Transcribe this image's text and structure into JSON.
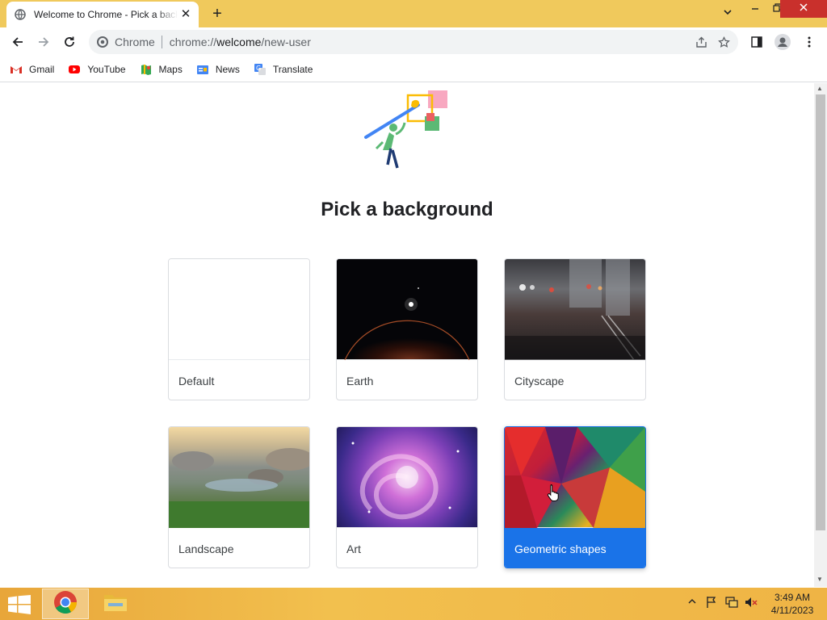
{
  "browser": {
    "tab_title": "Welcome to Chrome - Pick a background",
    "new_tab_symbol": "+",
    "omnibox": {
      "chip_label": "Chrome",
      "url_prefix": "chrome://",
      "url_host": "welcome",
      "url_path": "/new-user"
    },
    "bookmarks": [
      {
        "label": "Gmail",
        "icon": "gmail-icon"
      },
      {
        "label": "YouTube",
        "icon": "youtube-icon"
      },
      {
        "label": "Maps",
        "icon": "maps-icon"
      },
      {
        "label": "News",
        "icon": "news-icon"
      },
      {
        "label": "Translate",
        "icon": "translate-icon"
      }
    ]
  },
  "page": {
    "heading": "Pick a background",
    "backgrounds": [
      {
        "label": "Default",
        "selected": false
      },
      {
        "label": "Earth",
        "selected": false
      },
      {
        "label": "Cityscape",
        "selected": false
      },
      {
        "label": "Landscape",
        "selected": false
      },
      {
        "label": "Art",
        "selected": false
      },
      {
        "label": "Geometric shapes",
        "selected": true
      }
    ]
  },
  "taskbar": {
    "clock_time": "3:49 AM",
    "clock_date": "4/11/2023"
  },
  "colors": {
    "tab_strip": "#f0c95c",
    "accent": "#1a73e8",
    "close_red": "#c9302c"
  }
}
